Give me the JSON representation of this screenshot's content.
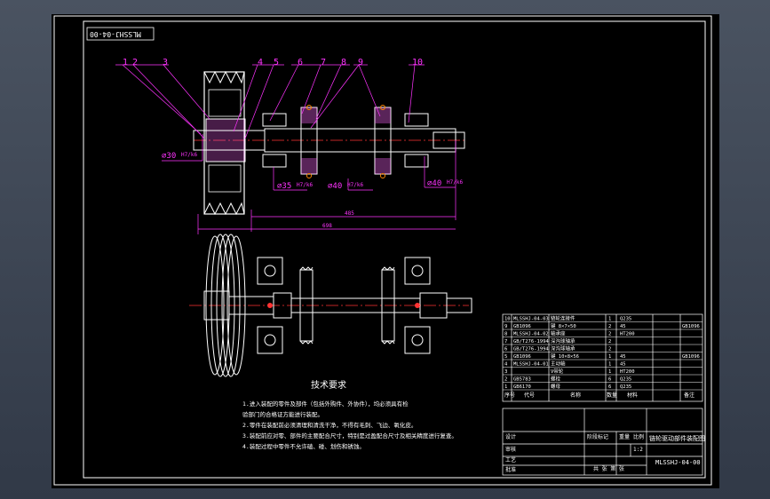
{
  "drawing_code_rotated": "MLSSHJ-04-00",
  "balloons": [
    "1",
    "2",
    "3",
    "4",
    "5",
    "6",
    "7",
    "8",
    "9",
    "10"
  ],
  "dimensions": {
    "d30": "⌀30",
    "fit30": "H7/k6",
    "d35": "⌀35",
    "fit35": "H7/k6",
    "d40a": "⌀40",
    "fit40a": "H7/k6",
    "d40b": "⌀40",
    "fit40b": "H7/k6",
    "len_inner": "485",
    "len_overall": "698"
  },
  "tech_req": {
    "title": "技术要求",
    "lines": [
      "1.进入装配的零件及部件（包括外购件、外协件），均必须具有检",
      "验部门的合格证方能进行装配。",
      "2.零件在装配前必须清理和清洗干净，不得有毛刺、飞边、氧化皮。",
      "3.装配前应对零、部件的主要配合尺寸，特别是过盈配合尺寸及相关精度进行复查。",
      "4.装配过程中零件不允许磕、碰、划伤和锈蚀。"
    ]
  },
  "bom": [
    {
      "no": "10",
      "code": "MLSSHJ-04-03",
      "name": "链轮连接件",
      "qty": "1",
      "mat": "Q235",
      "note": ""
    },
    {
      "no": "9",
      "code": "GB1096",
      "name": "键 8×7×50",
      "qty": "2",
      "mat": "45",
      "note": "GB1096"
    },
    {
      "no": "8",
      "code": "MLSSHJ-04-02",
      "name": "轴承座",
      "qty": "2",
      "mat": "HT200",
      "note": ""
    },
    {
      "no": "7",
      "code": "GB/T276-1994",
      "name": "深沟球轴承",
      "qty": "2",
      "mat": "",
      "note": ""
    },
    {
      "no": "6",
      "code": "GB/T276-1994",
      "name": "深沟球轴承",
      "qty": "2",
      "mat": "",
      "note": ""
    },
    {
      "no": "5",
      "code": "GB1096",
      "name": "键 10×8×56",
      "qty": "1",
      "mat": "45",
      "note": "GB1096"
    },
    {
      "no": "4",
      "code": "MLSSHJ-04-01",
      "name": "主动轴",
      "qty": "1",
      "mat": "45",
      "note": ""
    },
    {
      "no": "3",
      "code": "",
      "name": "V带轮",
      "qty": "1",
      "mat": "HT200",
      "note": ""
    },
    {
      "no": "2",
      "code": "GB5783",
      "name": "螺栓",
      "qty": "6",
      "mat": "Q235",
      "note": ""
    },
    {
      "no": "1",
      "code": "GB6170",
      "name": "螺母",
      "qty": "6",
      "mat": "Q235",
      "note": ""
    }
  ],
  "bom_header": {
    "no": "序号",
    "code": "代号",
    "name": "名称",
    "qty": "数量",
    "mat": "材料",
    "note": "备注"
  },
  "title_block": {
    "drawing_name": "链轮驱动部件装配图",
    "drawing_code": "MLSSHJ-04-00",
    "scale": "1:2",
    "weight_label": "重量",
    "scale_label": "比例",
    "stage_label": "阶段标记",
    "sheets_label": "共 张 第 张",
    "designer_label": "设计",
    "check_label": "审核",
    "process_label": "工艺",
    "approve_label": "批准"
  },
  "colors": {
    "background_app": "#3c4553",
    "sheet": "#000000",
    "frame": "#ffffff",
    "part": "#ffffff",
    "leader": "#ff33ff",
    "center_line": "#ff3333",
    "dimension": "#ff33ff",
    "hatch_sprocket": "#ff8800"
  }
}
